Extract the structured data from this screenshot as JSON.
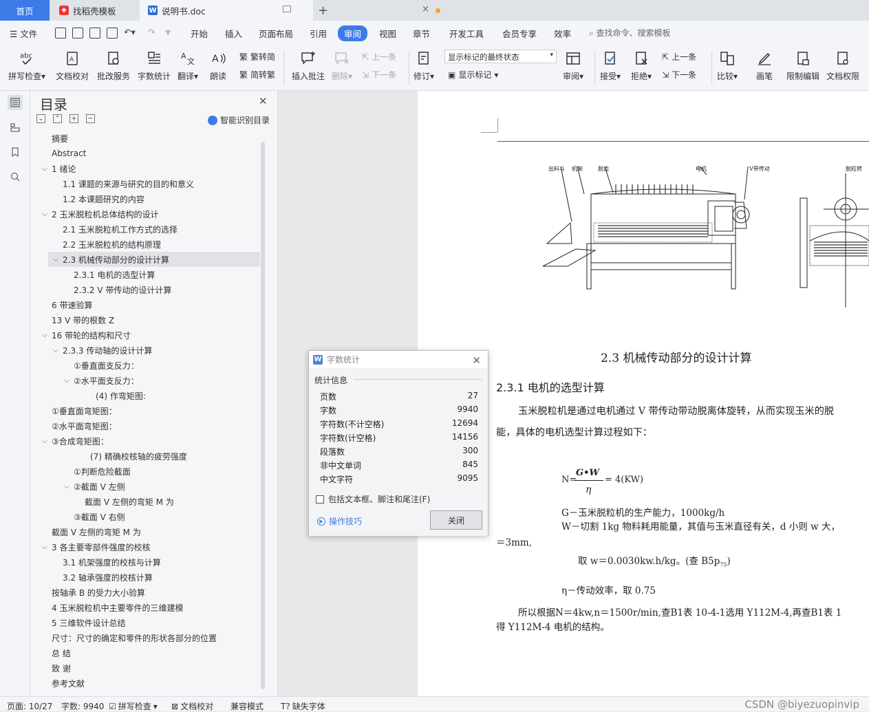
{
  "tabs": {
    "home": "首页",
    "template": "找稻壳模板",
    "doc": "说明书.doc"
  },
  "menu": {
    "file": "文件",
    "items": [
      "开始",
      "插入",
      "页面布局",
      "引用",
      "审阅",
      "视图",
      "章节",
      "开发工具",
      "会员专享",
      "效率"
    ],
    "search": "查找命令、搜索模板"
  },
  "ribbon": {
    "spell": "拼写检查",
    "proof": "文档校对",
    "revise_service": "批改服务",
    "word_count": "字数统计",
    "translate": "翻译",
    "read_aloud": "朗读",
    "trad_to_simp": "繁转简",
    "simp_to_trad": "简转繁",
    "insert_comment": "插入批注",
    "delete": "删除",
    "prev": "上一条",
    "next": "下一条",
    "track": "修订",
    "markup_state": "显示标记的最终状态",
    "show_markup": "显示标记",
    "review": "审阅",
    "accept": "接受",
    "reject": "拒绝",
    "prev2": "上一条",
    "next2": "下一条",
    "compare": "比较",
    "pen": "画笔",
    "restrict": "限制编辑",
    "doc_rights": "文档权限"
  },
  "toc": {
    "title": "目录",
    "smart": "智能识别目录",
    "items": [
      {
        "text": "摘要",
        "indent": 0
      },
      {
        "text": "Abstract",
        "indent": 0
      },
      {
        "text": "1  绪论",
        "indent": 0,
        "expand": "v"
      },
      {
        "text": "1.1  课题的来源与研究的目的和意义",
        "indent": 1
      },
      {
        "text": "1.2  本课题研究的内容",
        "indent": 1
      },
      {
        "text": "2 玉米脱粒机总体结构的设计",
        "indent": 0,
        "expand": "v"
      },
      {
        "text": "2.1  玉米脱粒机工作方式的选择",
        "indent": 1
      },
      {
        "text": "2.2  玉米脱粒机的结构原理",
        "indent": 1
      },
      {
        "text": "2.3  机械传动部分的设计计算",
        "indent": 1,
        "expand": "v",
        "selected": true
      },
      {
        "text": "2.3.1 电机的选型计算",
        "indent": 2
      },
      {
        "text": "2.3.2 V 带传动的设计计算",
        "indent": 2
      },
      {
        "text": "6  带速验算",
        "indent": 0
      },
      {
        "text": "13 V 带的根数 Z",
        "indent": 0
      },
      {
        "text": "16 带轮的结构和尺寸",
        "indent": 0,
        "expand": "v"
      },
      {
        "text": "2.3.3 传动轴的设计计算",
        "indent": 1,
        "expand": "v"
      },
      {
        "text": "①垂直面支反力：",
        "indent": 2
      },
      {
        "text": "②水平面支反力：",
        "indent": 2,
        "expand": "v"
      },
      {
        "text": "(4)  作弯矩图:",
        "indent": 4
      },
      {
        "text": "①垂直面弯矩图：",
        "indent": 0
      },
      {
        "text": "②水平面弯矩图：",
        "indent": 0
      },
      {
        "text": "③合成弯矩图：",
        "indent": 0,
        "expand": "v"
      },
      {
        "text": "(7)  精确校核轴的疲劳强度",
        "indent": 3.5
      },
      {
        "text": "①判断危险截面",
        "indent": 2
      },
      {
        "text": "②截面 V 左侧",
        "indent": 2,
        "expand": "v"
      },
      {
        "text": "截面 V 左侧的弯矩 M 为",
        "indent": 3
      },
      {
        "text": "③截面 V 右侧",
        "indent": 2
      },
      {
        "text": "截面 V 左侧的弯矩 M 为",
        "indent": 0
      },
      {
        "text": "3 各主要零部件强度的校核",
        "indent": 0,
        "expand": "v"
      },
      {
        "text": "3.1 机架强度的校核与计算",
        "indent": 1
      },
      {
        "text": "3.2 轴承强度的校核计算",
        "indent": 1
      },
      {
        "text": "按轴承 B 的受力大小验算",
        "indent": 0
      },
      {
        "text": "4 玉米脱粒机中主要零件的三维建模",
        "indent": 0
      },
      {
        "text": "5 三维软件设计总结",
        "indent": 0
      },
      {
        "text": "尺寸：尺寸的确定和零件的形状各部分的位置",
        "indent": 0
      },
      {
        "text": "总  结",
        "indent": 0
      },
      {
        "text": "致  谢",
        "indent": 0
      },
      {
        "text": "参考文献",
        "indent": 0
      }
    ]
  },
  "document": {
    "drawing_labels": [
      "出料斗",
      "机架",
      "脱齿",
      "电机",
      "V带传动",
      "脱粒转"
    ],
    "heading": "2.3  机械传动部分的设计计算",
    "subheading": "2.3.1 电机的选型计算",
    "para1_line1": "玉米脱粒机是通过电机通过 V 带传动带动脱离体旋转，从而实现玉米的脱",
    "para1_line2": "能，具体的电机选型计算过程如下：",
    "formula_left": "N=",
    "formula_num": "G•W",
    "formula_den": "η",
    "formula_right": "= 4(KW)",
    "g_def": "G－玉米脱粒机的生产能力，1000kg/h",
    "w_def": "W－切割 1kg 物料耗用能量，其值与玉米直径有关，d 小则 w 大，",
    "w_def2": "＝3mm,",
    "w_take_a": "取 w＝0.0030kw.h/kg。(查 B5p",
    "w_take_sub": "75",
    "w_take_b": ")",
    "eta_def": "η－传动效率，取 0.75",
    "para2_line1": "所以根据N＝4kw,n＝1500r/min,查B1表 10-4-1选用 Y112M-4,再查B1表 1",
    "para2_line2": "得 Y112M-4 电机的结构。"
  },
  "dialog": {
    "title": "字数统计",
    "section": "统计信息",
    "rows": [
      {
        "label": "页数",
        "value": "27"
      },
      {
        "label": "字数",
        "value": "9940"
      },
      {
        "label": "字符数(不计空格)",
        "value": "12694"
      },
      {
        "label": "字符数(计空格)",
        "value": "14156"
      },
      {
        "label": "段落数",
        "value": "300"
      },
      {
        "label": "非中文单词",
        "value": "845"
      },
      {
        "label": "中文字符",
        "value": "9095"
      }
    ],
    "checkbox": "包括文本框、脚注和尾注(F)",
    "tips": "操作技巧",
    "close": "关闭"
  },
  "status": {
    "page": "页面: 10/27",
    "words": "字数: 9940",
    "spell": "拼写检查",
    "proof": "文档校对",
    "compat": "兼容模式",
    "missing_font": "缺失字体",
    "watermark": "CSDN @biyezuopinvip"
  },
  "colors": {
    "accent": "#3b7ce8",
    "chrome": "#f3f5f8",
    "page": "#ffffff"
  }
}
